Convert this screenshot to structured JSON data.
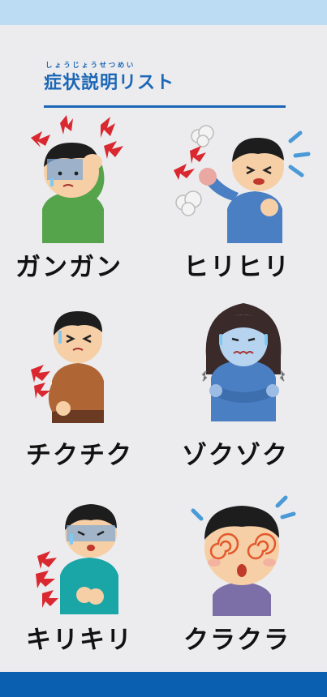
{
  "header": {
    "ruby": "しょうじょうせつめい",
    "title": "症状説明リスト"
  },
  "symptoms": [
    {
      "label": "ガンガン",
      "icon": "headache-pounding-illustration"
    },
    {
      "label": "ヒリヒリ",
      "icon": "stinging-burn-illustration"
    },
    {
      "label": "チクチク",
      "icon": "prickling-pain-illustration"
    },
    {
      "label": "ゾクゾク",
      "icon": "chills-illustration"
    },
    {
      "label": "キリキリ",
      "icon": "stomach-cramp-illustration"
    },
    {
      "label": "クラクラ",
      "icon": "dizziness-illustration"
    }
  ],
  "colors": {
    "accent": "#1b66b6",
    "top_bar": "#bcdcf3",
    "bottom_bar": "#0b5fb0",
    "background": "#ececee"
  }
}
